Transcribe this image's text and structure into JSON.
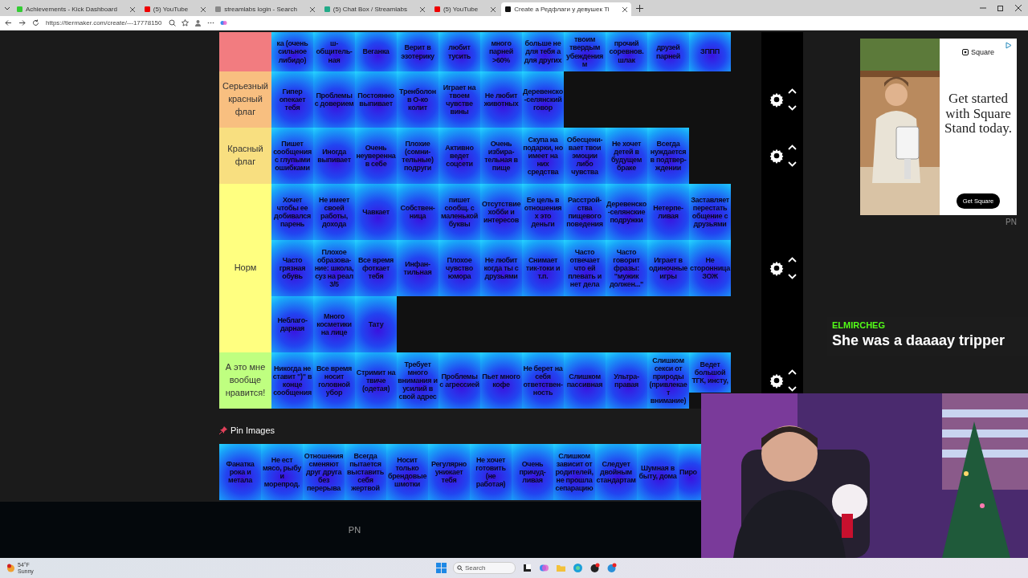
{
  "browser": {
    "tabs": [
      {
        "title": "Achievements - Kick Dashboard",
        "selected": false
      },
      {
        "title": "(5) YouTube",
        "selected": false
      },
      {
        "title": "streamlabs login - Search",
        "selected": false
      },
      {
        "title": "(5) Chat Box / Streamlabs",
        "selected": false
      },
      {
        "title": "(5) YouTube",
        "selected": false
      },
      {
        "title": "Create a Редфлаги у девушек Ti",
        "selected": true
      }
    ],
    "url": "https://tiermaker.com/create/---17778150"
  },
  "tier_list": {
    "tiers": [
      {
        "color": "#f27c80",
        "items": [
          "ка (очень сильное либидо)",
          "ш-общитель-ная",
          "Веганка",
          "Верит в эзотерику",
          "любит тусить",
          "много парней >60%",
          "больше не для тебя а для других",
          "твоим твердым убеждениям",
          "прочий соревнов. шлак",
          "друзей парней",
          "ЗППП"
        ]
      },
      {
        "label": "Серьезный красный флаг",
        "color": "#f8bf80",
        "items": [
          "Гипер опекает тебя",
          "Проблемы с доверием",
          "Постоянно выпивает",
          "Тренболон в О-ко колит",
          "Играет на твоем чувстве вины",
          "Не любит животных",
          "Деревенско-селянский говор"
        ]
      },
      {
        "label": "Красный флаг",
        "color": "#f8df80",
        "items": [
          "Пишет сообщения с глупыми ошибками",
          "Иногда выпивает",
          "Очень неуверенна в себе",
          "Плохие (сомни-тельные) подруги",
          "Активно ведет соцсети",
          "Очень избира-тельная в пище",
          "Скупа на подарки, но имеет на них средства",
          "Обесцени-вает твои эмоции либо чувства",
          "Не хочет детей в будущем браке",
          "Всегда нуждается в подтвер-ждении"
        ]
      },
      {
        "label": "Норм",
        "color": "#ffff80",
        "items": [
          "Хочет чтобы ее добивался парень",
          "Не имеет своей работы, дохода",
          "Чавкает",
          "Собствен-ница",
          "пишет сообщ. с маленькой буквы",
          "Отсутствие хобби и интересов",
          "Ее цель в отношениях это деньги",
          "Расстрой-ства пищевого поведения",
          "Деревенско-селянские подружки",
          "Нетерпе-ливая",
          "Заставляет перестать общение с друзьями",
          "Часто грязная обувь",
          "Плохое образова-ние: школа, суз на реал 3/5",
          "Все время фоткает тебя",
          "Инфан-тильная",
          "Плохое чувство юмора",
          "Не любит когда ты с друзьями",
          "Снимает тик-токи и т.п.",
          "Часто отвечает что ей плевать и нет дела",
          "Часто говорит фразы: \"мужик должен...\"",
          "Играет в одиночные игры",
          "Не сторонница ЗОЖ",
          "Неблаго-дарная",
          "Много косметики на лице",
          "Тату"
        ]
      },
      {
        "label": "А это мне вообще нравится!",
        "color": "#bfff80",
        "items": [
          "Никогда не ставит \")\" в конце сообщения",
          "Все время носит головной убор",
          "Стримит на твиче (одетая)",
          "Требует много внимания и усилий в свой адрес",
          "Проблемы с агрессией",
          "Пьет много кофе",
          "Не берет на себя ответствен-ность",
          "Слишком пассивная",
          "Ультра-правая",
          "Слишком секси от природы (привлекает внимание)",
          "Ведет большой ТГК, инсту,"
        ]
      }
    ]
  },
  "pin_images": {
    "title": "Pin Images",
    "items": [
      "Фанатка рока и метала",
      "Не ест мясо, рыбу и морепрод.",
      "Отношения сменяют друг друга без перерыва",
      "Всегда пытается выставить себя жертвой",
      "Носит только брендовые шмотки",
      "Регулярно унижает тебя",
      "Не хочет готовить (не работая)",
      "Очень причуд-ливая",
      "Слишком зависит от родителей, не прошла сепарацию",
      "Следует двойным стандартам",
      "Шумная в быту, дома",
      "Пиро"
    ]
  },
  "overlay_label": "PN",
  "ad": {
    "brand": "Square",
    "headline": "Get started with Square Stand today.",
    "button": "Get Square"
  },
  "stream_label": "PN",
  "chat_message": {
    "username": "ELMIRCHEG",
    "text": "She was a daaaay tripper"
  },
  "taskbar": {
    "temperature": "54°F",
    "weather": "Sunny",
    "search_placeholder": "Search"
  }
}
